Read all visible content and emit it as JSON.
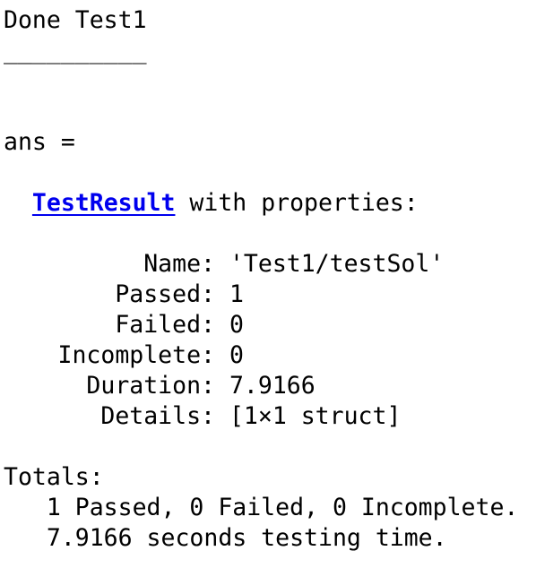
{
  "console": {
    "done_line": "Done Test1",
    "separator": "__________",
    "ans_line": "ans =",
    "result_class_link": "TestResult",
    "result_suffix": " with properties:",
    "properties": [
      {
        "name": "Name:",
        "value": " 'Test1/testSol'"
      },
      {
        "name": "Passed:",
        "value": " 1"
      },
      {
        "name": "Failed:",
        "value": " 0"
      },
      {
        "name": "Incomplete:",
        "value": " 0"
      },
      {
        "name": "Duration:",
        "value": " 7.9166"
      },
      {
        "name": "Details:",
        "value": " [1×1 struct]"
      }
    ],
    "totals_label": "Totals:",
    "totals_summary": "   1 Passed, 0 Failed, 0 Incomplete.",
    "totals_time": "   7.9166 seconds testing time."
  }
}
